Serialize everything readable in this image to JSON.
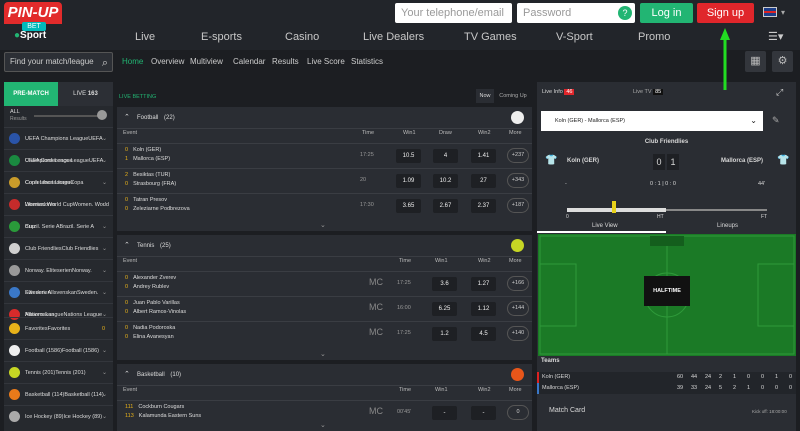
{
  "header": {
    "logo_top": "PIN-UP",
    "logo_bet": "BET",
    "logo_sport": "Sport",
    "phone_placeholder": "Your telephone/email",
    "password_placeholder": "Password",
    "login": "Log in",
    "signup": "Sign up"
  },
  "nav": [
    "Live",
    "E-sports",
    "Casino",
    "Live Dealers",
    "TV Games",
    "V-Sport",
    "Promo"
  ],
  "search_placeholder": "Find your match/league",
  "subnav": [
    "Home",
    "Overview",
    "Multiview",
    "Calendar",
    "Results",
    "Live Score",
    "Statistics"
  ],
  "sidebar": {
    "prematch": "PRE-MATCH",
    "live": "LIVE",
    "live_count": "163",
    "all": "ALL",
    "results": "Results",
    "items": [
      {
        "label": "UEFA Champions League",
        "color": "#2a54a8"
      },
      {
        "label": "UEFA Conference League",
        "color": "#1a8a40"
      },
      {
        "label": "Copa Libertadores",
        "color": "#c89b2a"
      },
      {
        "label": "Women. World Cup",
        "color": "#c62b2b"
      },
      {
        "label": "Brazil. Serie A",
        "color": "#2a9a3a"
      },
      {
        "label": "Club Friendlies",
        "color": "#d0d0d0"
      },
      {
        "label": "Norway. Eliteserien",
        "color": "#999"
      },
      {
        "label": "Sweden. Allsvenskan",
        "color": "#3a78c8"
      },
      {
        "label": "Nations League",
        "color": "#d62b2b"
      },
      {
        "label": "Favorites",
        "color": "#e8b21a",
        "count": "0"
      },
      {
        "label": "Football (1586)",
        "color": "#eeeeee"
      },
      {
        "label": "Tennis (201)",
        "color": "#c6d624"
      },
      {
        "label": "Basketball (114)",
        "color": "#e87a1a"
      },
      {
        "label": "Ice Hockey (89)",
        "color": "#aaaaaa"
      }
    ]
  },
  "live_betting": "LIVE BETTING",
  "now": "Now",
  "coming_up": "Coming Up",
  "cols": {
    "event": "Event",
    "time": "Time",
    "win1": "Win1",
    "draw": "Draw",
    "win2": "Win2",
    "more": "More"
  },
  "football": {
    "title": "Football",
    "count": "(22)",
    "rows": [
      {
        "n1": "0",
        "t1": "Koln (GER)",
        "n2": "1",
        "t2": "Mallorca (ESP)",
        "time": "17:25",
        "o1": "10.5",
        "o2": "4",
        "o3": "1.41",
        "more": "+237"
      },
      {
        "n1": "2",
        "t1": "Besiktas (TUR)",
        "n2": "0",
        "t2": "Strasbourg (FRA)",
        "time": "20",
        "o1": "1.09",
        "o2": "10.2",
        "o3": "27",
        "more": "+343"
      },
      {
        "n1": "0",
        "t1": "Tatran Presov",
        "n2": "0",
        "t2": "Zeleziarne Podbrezova",
        "time": "17:30",
        "o1": "3.65",
        "o2": "2.67",
        "o3": "2.37",
        "more": "+187"
      }
    ]
  },
  "tennis": {
    "title": "Tennis",
    "count": "(25)",
    "rows": [
      {
        "n1": "0",
        "t1": "Alexander Zverev",
        "n2": "0",
        "t2": "Andrey Rublev",
        "time": "17:25",
        "o1": "3.6",
        "o3": "1.27",
        "more": "+166"
      },
      {
        "n1": "0",
        "t1": "Juan Pablo Varillas",
        "n2": "0",
        "t2": "Albert Ramos-Vinolas",
        "time": "16:00",
        "o1": "6.25",
        "o3": "1.12",
        "more": "+144"
      },
      {
        "n1": "0",
        "t1": "Nadia Podoroska",
        "n2": "0",
        "t2": "Elina Avanesyan",
        "time": "17:25",
        "o1": "1.2",
        "o3": "4.5",
        "more": "+140"
      }
    ]
  },
  "basketball": {
    "title": "Basketball",
    "count": "(10)",
    "rows": [
      {
        "n1": "111",
        "t1": "Cockburn Cougars",
        "n2": "113",
        "t2": "Kalamunda Eastern Suns",
        "time": "00'45'",
        "o1": "-",
        "o3": "-",
        "more": "0"
      }
    ]
  },
  "right": {
    "live_info": "Live Info",
    "live_info_count": "46",
    "live_tv": "Live TV",
    "live_tv_count": "85",
    "match_select": "Koln (GER) - Mallorca (ESP)",
    "league": "Club Friendlies",
    "home": "Koln (GER)",
    "away": "Mallorca (ESP)",
    "score_home": "0",
    "score_away": "1",
    "mini": "0 : 1 | 0 : 0",
    "minute": "44'",
    "dash": "-",
    "t0": "0",
    "ht": "HT",
    "ft": "FT",
    "live_view": "Live View",
    "lineups": "Lineups",
    "halftime": "HALFTIME",
    "teams": "Teams",
    "stats": [
      {
        "team": "Koln (GER)",
        "v": [
          "60",
          "44",
          "24",
          "2",
          "1",
          "0",
          "0",
          "1",
          "0"
        ]
      },
      {
        "team": "Mallorca (ESP)",
        "v": [
          "39",
          "33",
          "24",
          "5",
          "2",
          "1",
          "0",
          "0",
          "0"
        ]
      }
    ],
    "match_card": "Match Card",
    "kickoff": "Kick off: 18:00:00"
  },
  "colors": {
    "accent": "#22b573",
    "brand": "#e0262b",
    "arrow": "#22dd22"
  }
}
